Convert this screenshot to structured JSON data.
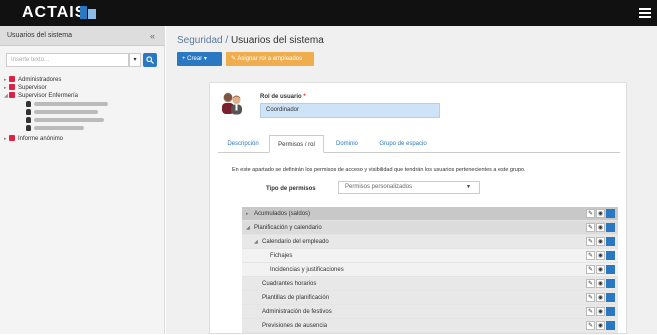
{
  "app": {
    "logo": "ACTAIS"
  },
  "sidebar": {
    "title": "Usuarios del sistema",
    "collapse": "«",
    "search_placeholder": "Inserte texto...",
    "tree": [
      {
        "label": "Administradores",
        "level": 0,
        "toggle": "▸"
      },
      {
        "label": "Supervisor",
        "level": 0,
        "toggle": "▸"
      },
      {
        "label": "Supervisor Enfermería",
        "level": 0,
        "toggle": "◢"
      },
      {
        "label": "Informe anónimo",
        "level": 0,
        "toggle": "▸"
      }
    ]
  },
  "header": {
    "breadcrumb_section": "Seguridad",
    "breadcrumb_sep": " / ",
    "breadcrumb_page": "Usuarios del sistema"
  },
  "toolbar": {
    "create_label": "+ Crear ▾",
    "assign_label": "✎ Asignar rol a empleados"
  },
  "form": {
    "role_label": "Rol de usuario",
    "required_mark": "*",
    "role_value": "Coordinador",
    "tabs": [
      "Descripción",
      "Permisos / rol",
      "Dominio",
      "Grupo de espacio"
    ],
    "active_tab": 1,
    "description": "En este apartado se definirán los permisos de acceso y visibilidad que tendrán los usuarios pertenecientes a este grupo.",
    "permission_type_label": "Tipo de permisos",
    "permission_type_value": "Permisos personalizados"
  },
  "permissions": [
    {
      "label": "Acumulados (saldos)",
      "toggle": "▸",
      "level": 0
    },
    {
      "label": "Planificación y calendario",
      "toggle": "◢",
      "level": 0
    },
    {
      "label": "Calendario del empleado",
      "toggle": "◢",
      "level": 1
    },
    {
      "label": "Fichajes",
      "toggle": "",
      "level": 2
    },
    {
      "label": "Incidencias y justificaciones",
      "toggle": "",
      "level": 2
    },
    {
      "label": "Cuadrantes horarios",
      "toggle": "",
      "level": 1
    },
    {
      "label": "Plantillas de planificación",
      "toggle": "",
      "level": 1
    },
    {
      "label": "Administración de festivos",
      "toggle": "",
      "level": 1
    },
    {
      "label": "Previsiones de ausencia",
      "toggle": "",
      "level": 1
    }
  ],
  "colors": {
    "accent": "#2a78c2",
    "assign": "#f0ad4e",
    "topbar": "#111111"
  }
}
